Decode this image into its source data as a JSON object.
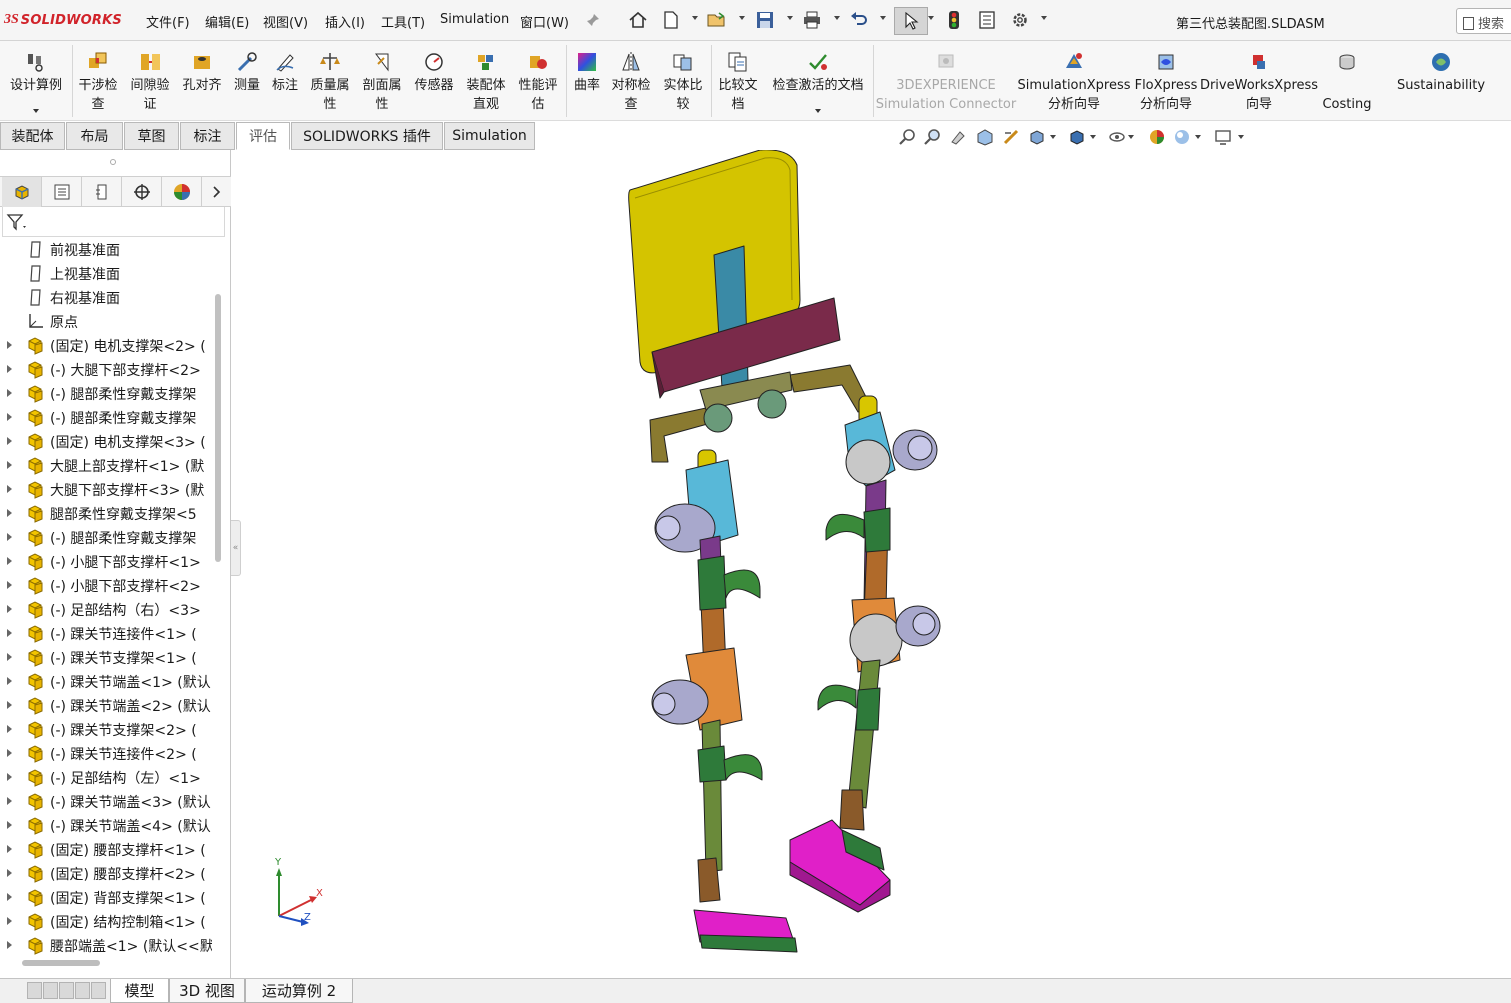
{
  "app": {
    "logo_mark": "3S",
    "logo_text": "SOLIDWORKS",
    "document_title": "第三代总装配图.SLDASM",
    "search_placeholder": "搜索"
  },
  "menu": [
    "文件(F)",
    "编辑(E)",
    "视图(V)",
    "插入(I)",
    "工具(T)",
    "Simulation",
    "窗口(W)"
  ],
  "ribbon": [
    {
      "label": "设计算例",
      "icon": "design-study-icon",
      "color": "#444444"
    },
    {
      "label": "干涉检\n查",
      "icon": "interference-check-icon",
      "color": "#c98a1a"
    },
    {
      "label": "间隙验\n证",
      "icon": "clearance-icon",
      "color": "#c98a1a"
    },
    {
      "label": "孔对齐",
      "icon": "hole-align-icon",
      "color": "#c98a1a"
    },
    {
      "label": "测量",
      "icon": "measure-icon",
      "color": "#3a6fb0"
    },
    {
      "label": "标注",
      "icon": "markup-icon",
      "color": "#3a6fb0"
    },
    {
      "label": "质量属\n性",
      "icon": "mass-properties-icon",
      "color": "#555555"
    },
    {
      "label": "剖面属\n性",
      "icon": "section-properties-icon",
      "color": "#555555"
    },
    {
      "label": "传感器",
      "icon": "sensor-icon",
      "color": "#555555"
    },
    {
      "label": "装配体\n直观",
      "icon": "assembly-visualization-icon",
      "color": "#c98a1a"
    },
    {
      "label": "性能评\n估",
      "icon": "performance-icon",
      "color": "#c03030"
    },
    {
      "label": "曲率",
      "icon": "curvature-icon",
      "color": "#d43bb0"
    },
    {
      "label": "对称检\n查",
      "icon": "symmetry-check-icon",
      "color": "#3a6fb0"
    },
    {
      "label": "实体比\n较",
      "icon": "compare-bodies-icon",
      "color": "#3a6fb0"
    },
    {
      "label": "比较文\n档",
      "icon": "compare-documents-icon",
      "color": "#444444"
    },
    {
      "label": "检查激活的文档",
      "icon": "check-document-icon",
      "color": "#2e8b2e"
    },
    {
      "label": "3DEXPERIENCE\nSimulation Connector",
      "icon": "3dexperience-icon",
      "color": "#a8a8a8"
    },
    {
      "label": "SimulationXpress\n分析向导",
      "icon": "simulationxpress-icon",
      "color": "#3a6fb0"
    },
    {
      "label": "FloXpress\n分析向导",
      "icon": "floxpress-icon",
      "color": "#3a6fb0"
    },
    {
      "label": "DriveWorksXpress\n向导",
      "icon": "driveworksxpress-icon",
      "color": "#c03030"
    },
    {
      "label": "Costing",
      "icon": "costing-icon",
      "color": "#555555"
    },
    {
      "label": "Sustainability",
      "icon": "sustainability-icon",
      "color": "#2e6fb0"
    }
  ],
  "tabs": [
    "装配体",
    "布局",
    "草图",
    "标注",
    "评估",
    "SOLIDWORKS 插件",
    "Simulation"
  ],
  "active_tab": "评估",
  "tree": [
    {
      "text": "前视基准面",
      "type": "plane",
      "expand": false
    },
    {
      "text": "上视基准面",
      "type": "plane",
      "expand": false
    },
    {
      "text": "右视基准面",
      "type": "plane",
      "expand": false
    },
    {
      "text": "原点",
      "type": "origin",
      "expand": false
    },
    {
      "text": "(固定) 电机支撑架<2> (",
      "type": "part",
      "expand": true
    },
    {
      "text": "(-) 大腿下部支撑杆<2>",
      "type": "part",
      "expand": true
    },
    {
      "text": "(-) 腿部柔性穿戴支撑架",
      "type": "part",
      "expand": true
    },
    {
      "text": "(-) 腿部柔性穿戴支撑架",
      "type": "part",
      "expand": true
    },
    {
      "text": "(固定) 电机支撑架<3> (",
      "type": "part",
      "expand": true
    },
    {
      "text": "大腿上部支撑杆<1> (默",
      "type": "part",
      "expand": true
    },
    {
      "text": "大腿下部支撑杆<3> (默",
      "type": "part",
      "expand": true
    },
    {
      "text": "腿部柔性穿戴支撑架<5",
      "type": "part",
      "expand": true
    },
    {
      "text": "(-) 腿部柔性穿戴支撑架",
      "type": "part",
      "expand": true
    },
    {
      "text": "(-) 小腿下部支撑杆<1>",
      "type": "part",
      "expand": true
    },
    {
      "text": "(-) 小腿下部支撑杆<2>",
      "type": "part",
      "expand": true
    },
    {
      "text": "(-) 足部结构（右）<3>",
      "type": "part",
      "expand": true
    },
    {
      "text": "(-) 踝关节连接件<1> (",
      "type": "part",
      "expand": true
    },
    {
      "text": "(-) 踝关节支撑架<1> (",
      "type": "part",
      "expand": true
    },
    {
      "text": "(-) 踝关节端盖<1> (默认",
      "type": "part",
      "expand": true
    },
    {
      "text": "(-) 踝关节端盖<2> (默认",
      "type": "part",
      "expand": true
    },
    {
      "text": "(-) 踝关节支撑架<2> (",
      "type": "part",
      "expand": true
    },
    {
      "text": "(-) 踝关节连接件<2> (",
      "type": "part",
      "expand": true
    },
    {
      "text": "(-) 足部结构（左）<1>",
      "type": "part",
      "expand": true
    },
    {
      "text": "(-) 踝关节端盖<3> (默认",
      "type": "part",
      "expand": true
    },
    {
      "text": "(-) 踝关节端盖<4> (默认",
      "type": "part",
      "expand": true
    },
    {
      "text": "(固定) 腰部支撑杆<1> (",
      "type": "part",
      "expand": true
    },
    {
      "text": "(固定) 腰部支撑杆<2> (",
      "type": "part",
      "expand": true
    },
    {
      "text": "(固定) 背部支撑架<1> (",
      "type": "part",
      "expand": true
    },
    {
      "text": "(固定) 结构控制箱<1> (",
      "type": "part",
      "expand": true
    },
    {
      "text": "腰部端盖<1> (默认<<默",
      "type": "part",
      "expand": true
    }
  ],
  "bottom_tabs": [
    "模型",
    "3D 视图",
    "运动算例 2"
  ],
  "active_bottom_tab": "模型",
  "triad": {
    "x": "X",
    "y": "Y",
    "z": "Z"
  },
  "colors": {
    "accent": "#d1232a",
    "part_icon": "#e8b400",
    "tab_bg": "#e8e8e8"
  }
}
